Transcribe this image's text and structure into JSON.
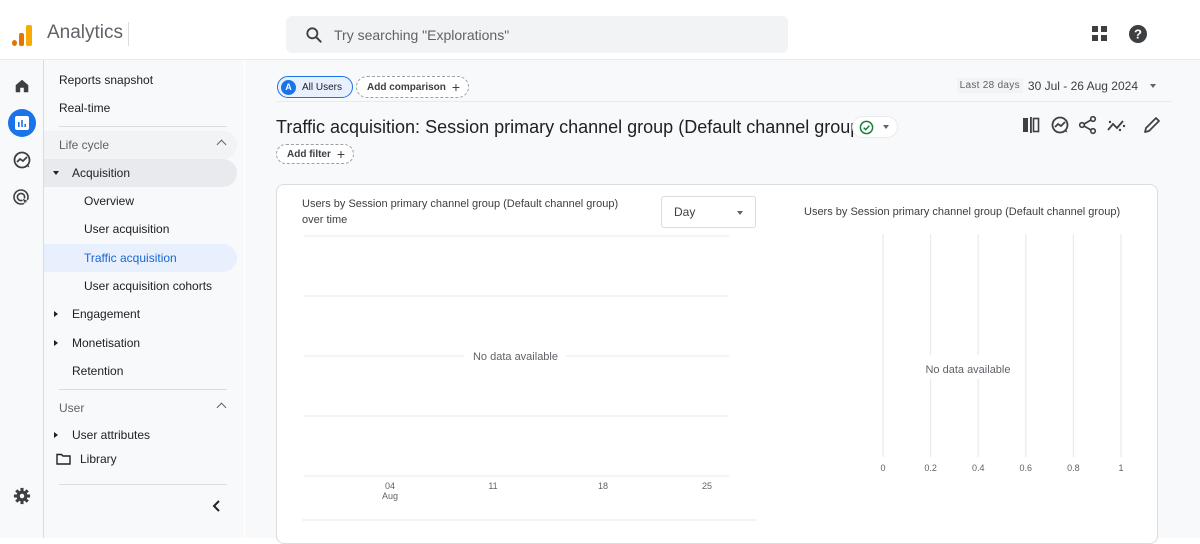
{
  "app": {
    "name": "Analytics",
    "brand_colors": {
      "bar_dark": "#e37400",
      "bar_light": "#f9ab00",
      "accent": "#1a73e8"
    }
  },
  "search": {
    "placeholder": "Try searching \"Explorations\""
  },
  "topbar_icons": [
    "apps-grid-icon",
    "help-icon"
  ],
  "rail": {
    "items": [
      {
        "icon": "home-icon",
        "active": false
      },
      {
        "icon": "reports-icon",
        "active": true
      },
      {
        "icon": "explore-icon",
        "active": false
      },
      {
        "icon": "advertising-icon",
        "active": false
      }
    ],
    "bottom_icon": "settings-gear-icon"
  },
  "sidebar": {
    "reports_snapshot": "Reports snapshot",
    "realtime": "Real-time",
    "lifecycle": {
      "label": "Life cycle",
      "acquisition": {
        "label": "Acquisition",
        "children": [
          "Overview",
          "User acquisition",
          "Traffic acquisition",
          "User acquisition cohorts"
        ],
        "selected": "Traffic acquisition"
      },
      "engagement": "Engagement",
      "monetisation": "Monetisation",
      "retention": "Retention"
    },
    "user": {
      "label": "User",
      "user_attributes": "User attributes"
    },
    "library": "Library",
    "collapse_icon": "chevron-left-icon"
  },
  "main": {
    "comparison": {
      "all_users_badge": "A",
      "all_users_label": "All Users",
      "add_comparison": "Add comparison"
    },
    "date_range": {
      "label": "Last 28 days",
      "value": "30 Jul - 26 Aug 2024"
    },
    "title": "Traffic acquisition: Session primary channel group (Default channel group)",
    "status": "verified",
    "add_filter": "Add filter",
    "toolbar_icons": [
      "compare-columns-icon",
      "insights-icon",
      "share-icon",
      "trend-sparkline-icon",
      "edit-pencil-icon"
    ]
  },
  "chart_data": [
    {
      "type": "line",
      "title": "Users by Session primary channel group (Default channel group) over time",
      "granularity_select": "Day",
      "x_ticks": [
        {
          "day": "04",
          "month": "Aug"
        },
        {
          "day": "11",
          "month": ""
        },
        {
          "day": "18",
          "month": ""
        },
        {
          "day": "25",
          "month": ""
        }
      ],
      "series": [],
      "empty_message": "No data available",
      "grid": true
    },
    {
      "type": "bar",
      "title": "Users by Session primary channel group (Default channel group)",
      "x_ticks": [
        "0",
        "0.2",
        "0.4",
        "0.6",
        "0.8",
        "1"
      ],
      "xlim": [
        0,
        1
      ],
      "categories": [],
      "values": [],
      "empty_message": "No data available",
      "grid": true
    }
  ]
}
